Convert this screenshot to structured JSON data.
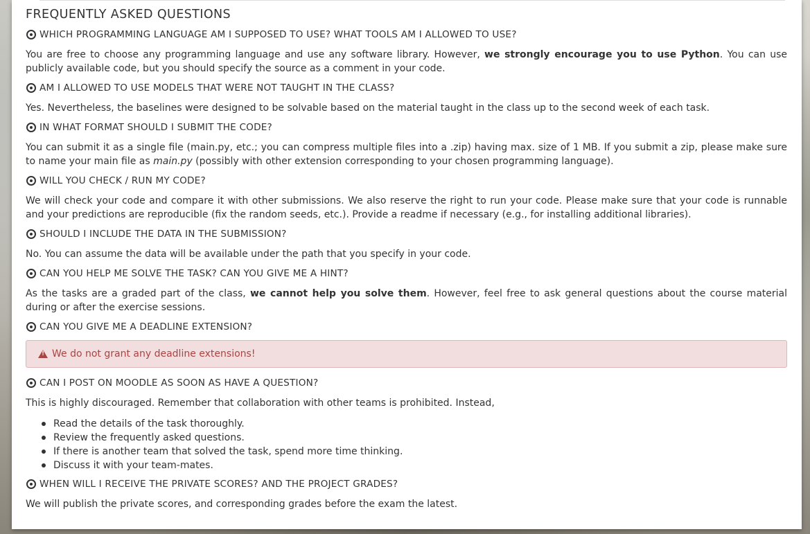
{
  "page_title": "FREQUENTLY ASKED QUESTIONS",
  "faq": {
    "q1": "WHICH PROGRAMMING LANGUAGE AM I SUPPOSED TO USE? WHAT TOOLS AM I ALLOWED TO USE?",
    "a1_pre": "You are free to choose any programming language and use any software library. However, ",
    "a1_bold": "we strongly encourage you to use Python",
    "a1_post": ". You can use publicly available code, but you should specify the source as a comment in your code.",
    "q2": "AM I ALLOWED TO USE MODELS THAT WERE NOT TAUGHT IN THE CLASS?",
    "a2": "Yes. Nevertheless, the baselines were designed to be solvable based on the material taught in the class up to the second week of each task.",
    "q3": "IN WHAT FORMAT SHOULD I SUBMIT THE CODE?",
    "a3_pre": "You can submit it as a single file (main.py, etc.; you can compress multiple files into a .zip) having max. size of 1 MB. If you submit a zip, please make sure to name your main file as ",
    "a3_italic": "main.py",
    "a3_post": " (possibly with other extension corresponding to your chosen programming language).",
    "q4": "WILL YOU CHECK / RUN MY CODE?",
    "a4": "We will check your code and compare it with other submissions. We also reserve the right to run your code. Please make sure that your code is runnable and your predictions are reproducible (fix the random seeds, etc.). Provide a readme if necessary (e.g., for installing additional libraries).",
    "q5": "SHOULD I INCLUDE THE DATA IN THE SUBMISSION?",
    "a5": "No. You can assume the data will be available under the path that you specify in your code.",
    "q6": "CAN YOU HELP ME SOLVE THE TASK? CAN YOU GIVE ME A HINT?",
    "a6_pre": "As the tasks are a graded part of the class, ",
    "a6_bold": "we cannot help you solve them",
    "a6_post": ". However, feel free to ask general questions about the course material during or after the exercise sessions.",
    "q7": "CAN YOU GIVE ME A DEADLINE EXTENSION?",
    "a7_alert": "We do not grant any deadline extensions!",
    "q8": "CAN I POST ON MOODLE AS SOON AS HAVE A QUESTION?",
    "a8": "This is highly discouraged. Remember that collaboration with other teams is prohibited. Instead,",
    "a8_list": [
      "Read the details of the task thoroughly.",
      "Review the frequently asked questions.",
      "If there is another team that solved the task, spend more time thinking.",
      "Discuss it with your team-mates."
    ],
    "q9": "WHEN WILL I RECEIVE THE PRIVATE SCORES? AND THE PROJECT GRADES?",
    "a9": "We will publish the private scores, and corresponding grades before the exam the latest."
  },
  "icons": {
    "question": "dot-circle-icon",
    "alert": "warning-triangle-icon"
  },
  "colors": {
    "alert_text": "#a94442",
    "alert_bg": "#f2dede",
    "text": "#333333"
  }
}
